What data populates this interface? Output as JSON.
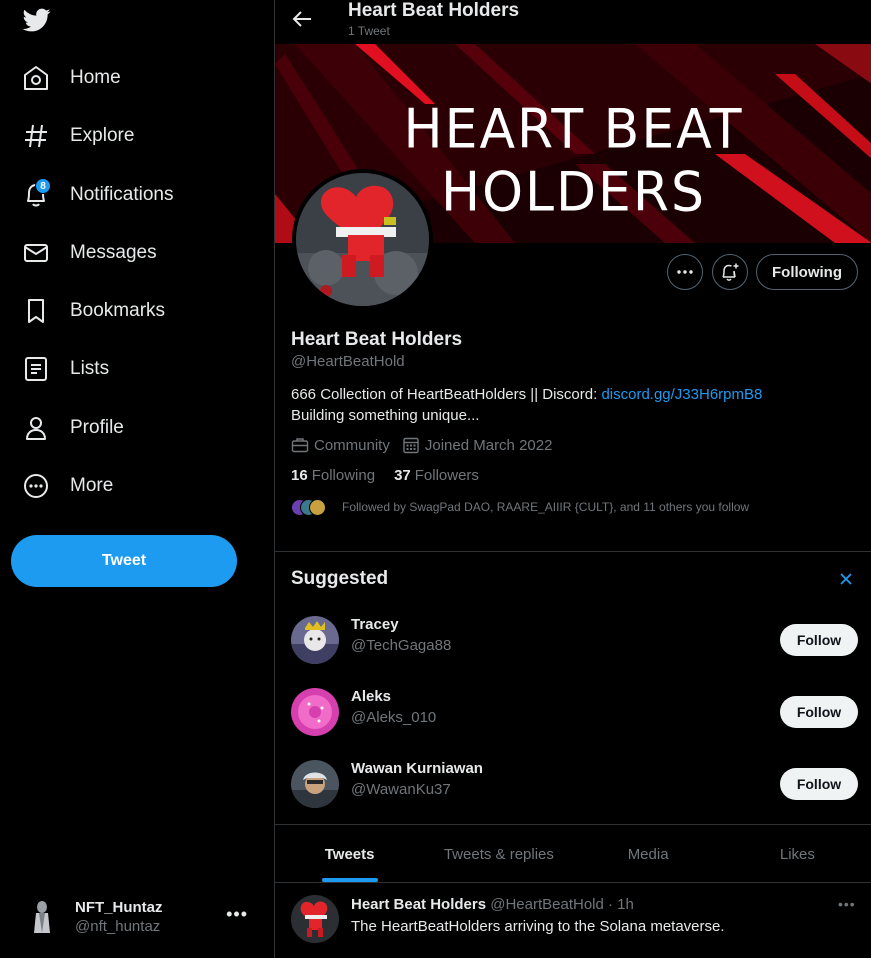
{
  "nav": {
    "items": [
      {
        "label": "Home",
        "icon": "home-icon"
      },
      {
        "label": "Explore",
        "icon": "hashtag-icon"
      },
      {
        "label": "Notifications",
        "icon": "bell-icon",
        "badge": "8"
      },
      {
        "label": "Messages",
        "icon": "envelope-icon"
      },
      {
        "label": "Bookmarks",
        "icon": "bookmark-icon"
      },
      {
        "label": "Lists",
        "icon": "list-icon"
      },
      {
        "label": "Profile",
        "icon": "person-icon"
      },
      {
        "label": "More",
        "icon": "more-circle-icon"
      }
    ],
    "tweet_button": "Tweet"
  },
  "account": {
    "name": "NFT_Huntaz",
    "handle": "@nft_huntaz",
    "menu_icon": "•••"
  },
  "header": {
    "title": "Heart Beat Holders",
    "subtitle": "1 Tweet"
  },
  "banner": {
    "text": "HEART BEAT HOLDERS"
  },
  "profile": {
    "name": "Heart Beat Holders",
    "handle": "@HeartBeatHold",
    "bio_text": "666 Collection of HeartBeatHolders || Discord: ",
    "bio_link": "discord.gg/J33H6rpmB8",
    "bio_line2": "Building something unique...",
    "category": "Community",
    "joined": "Joined March 2022",
    "following_count": "16",
    "following_label": "Following",
    "followers_count": "37",
    "followers_label": "Followers",
    "followed_by": "Followed by SwagPad DAO, RAARE_AIIIR {CULT}, and 11 others you follow",
    "following_button": "Following"
  },
  "suggested": {
    "title": "Suggested",
    "users": [
      {
        "name": "Tracey",
        "handle": "@TechGaga88",
        "button": "Follow"
      },
      {
        "name": "Aleks",
        "handle": "@Aleks_010",
        "button": "Follow"
      },
      {
        "name": "Wawan Kurniawan",
        "handle": "@WawanKu37",
        "button": "Follow"
      }
    ]
  },
  "tabs": [
    {
      "label": "Tweets",
      "active": true
    },
    {
      "label": "Tweets & replies",
      "active": false
    },
    {
      "label": "Media",
      "active": false
    },
    {
      "label": "Likes",
      "active": false
    }
  ],
  "tweet": {
    "author": "Heart Beat Holders",
    "handle": "@HeartBeatHold",
    "time": "· 1h",
    "text": "The HeartBeatHolders arriving to the Solana metaverse.",
    "menu_icon": "•••"
  },
  "colors": {
    "accent": "#1d9bf0",
    "background": "#000000",
    "muted": "#71767b",
    "border": "#2f3336"
  }
}
